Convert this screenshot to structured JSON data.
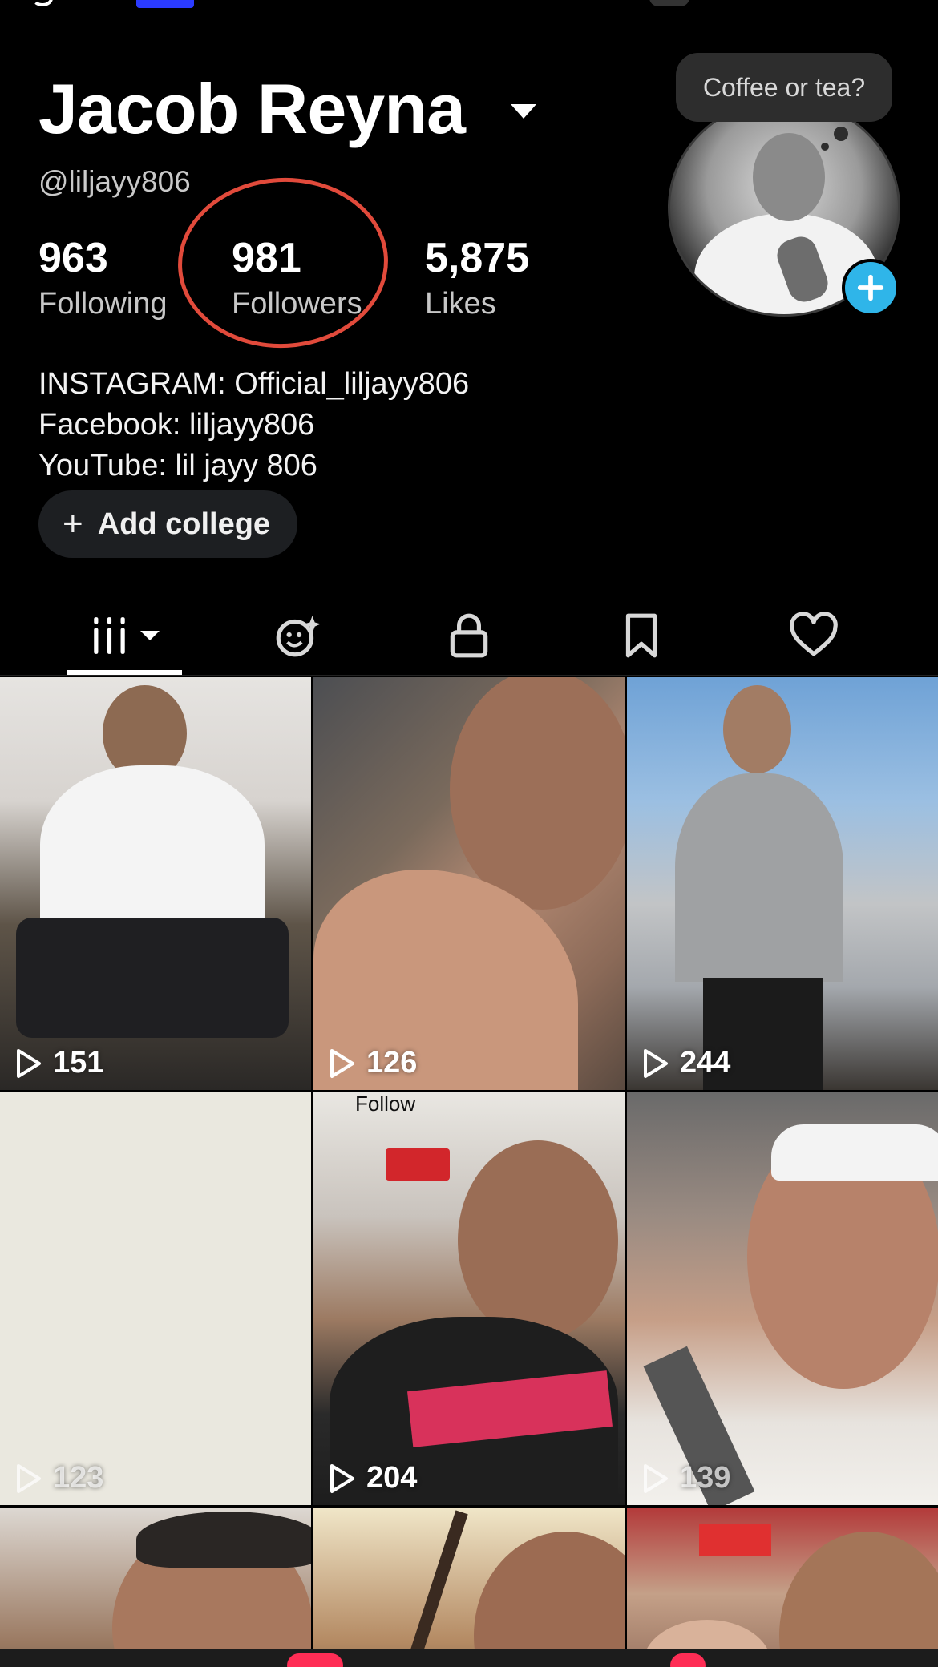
{
  "profile": {
    "name": "Jacob Reyna",
    "handle": "@liljayy806"
  },
  "stats": {
    "following": {
      "value": "963",
      "label": "Following"
    },
    "followers": {
      "value": "981",
      "label": "Followers"
    },
    "likes": {
      "value": "5,875",
      "label": "Likes"
    }
  },
  "bubble": {
    "text": "Coffee or tea?"
  },
  "bio": {
    "lines": [
      "INSTAGRAM: Official_liljayy806",
      "Facebook: liljayy806",
      "YouTube: lil jayy 806"
    ]
  },
  "add_college": {
    "plus": "+",
    "label": "Add college"
  },
  "tabs": [
    "videos",
    "reposts",
    "private",
    "saved",
    "liked"
  ],
  "videos": [
    {
      "views": "151"
    },
    {
      "views": "126"
    },
    {
      "views": "244"
    },
    {
      "views": "123"
    },
    {
      "views": "204",
      "overlay": "Follow"
    },
    {
      "views": "139"
    }
  ],
  "colors": {
    "background": "#000000",
    "highlight_circle": "#e14a3b",
    "add_button": "#2fb5e9",
    "badge": "#ff2d55"
  }
}
